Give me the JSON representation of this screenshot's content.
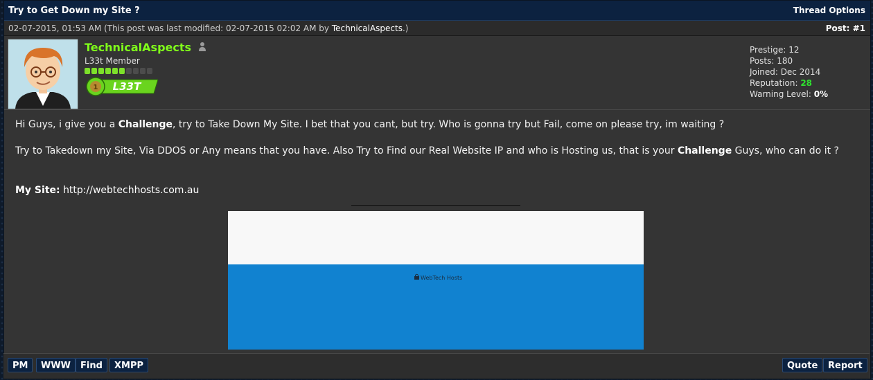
{
  "thread": {
    "title": "Try to Get Down my Site ?",
    "options_label": "Thread Options"
  },
  "post": {
    "meta_date": "02-07-2015, 01:53 AM (This post was last modified: 02-07-2015 02:02 AM by ",
    "meta_editor": "TechnicalAspects",
    "meta_close": ".)",
    "post_number": "Post: #1"
  },
  "author": {
    "name": "TechnicalAspects",
    "usertitle": "L33t Member",
    "stars_filled": 6,
    "stars_total": 10,
    "badge_text": "L33T",
    "badge_color": "#7de02a"
  },
  "stats": {
    "prestige_label": "Prestige: ",
    "prestige": "12",
    "posts_label": "Posts: ",
    "posts": "180",
    "joined_label": "Joined: ",
    "joined": "Dec 2014",
    "reputation_label": "Reputation: ",
    "reputation": "28",
    "warning_label": "Warning Level: ",
    "warning": "0%"
  },
  "body": {
    "p1_a": "Hi Guys, i give you a ",
    "p1_b": "Challenge",
    "p1_c": ", try to Take Down My Site. I bet that you cant, but try. Who is gonna try but Fail, come on please try, im waiting ?",
    "p2_a": "Try to Takedown my Site, Via DDOS or Any means that you have. Also Try to Find our Real Website IP and who is Hosting us, that is your ",
    "p2_b": "Challenge",
    "p2_c": " Guys, who can do it ?",
    "site_label": "My Site:",
    "site_url": "http://webtechhosts.com.au",
    "screenshot_logo": "WebTech Hosts"
  },
  "buttons": {
    "pm": "PM",
    "www": "WWW",
    "find": "Find",
    "xmpp": "XMPP",
    "quote": "Quote",
    "report": "Report"
  },
  "colors": {
    "header_bg": "#0c2240",
    "username": "#80ff1a",
    "reputation": "#2fe02f"
  }
}
